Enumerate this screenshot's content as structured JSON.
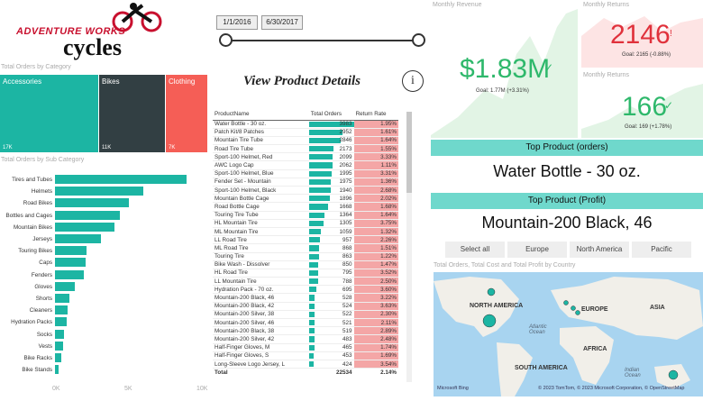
{
  "brand": {
    "line1": "ADVENTURE WORKS",
    "line2": "cycles"
  },
  "dates": {
    "start": "1/1/2016",
    "end": "6/30/2017"
  },
  "view_details": {
    "label": "View Product Details",
    "info_icon": "i"
  },
  "treemap": {
    "title": "Total Orders by Category",
    "tiles": [
      {
        "name": "Accessories",
        "value": "17K",
        "color": "#1cb5a3"
      },
      {
        "name": "Bikes",
        "value": "11K",
        "color": "#323f43"
      },
      {
        "name": "Clothing",
        "value": "7K",
        "color": "#f55e56"
      }
    ]
  },
  "subcat": {
    "title": "Total Orders by Sub Category",
    "axis": [
      "0K",
      "5K",
      "10K"
    ],
    "xmax": 10000,
    "rows": [
      {
        "name": "Tires and Tubes",
        "value": 9100
      },
      {
        "name": "Helmets",
        "value": 6100
      },
      {
        "name": "Road Bikes",
        "value": 5100
      },
      {
        "name": "Bottles and Cages",
        "value": 4500
      },
      {
        "name": "Mountain Bikes",
        "value": 4100
      },
      {
        "name": "Jerseys",
        "value": 3200
      },
      {
        "name": "Touring Bikes",
        "value": 2200
      },
      {
        "name": "Caps",
        "value": 2100
      },
      {
        "name": "Fenders",
        "value": 2000
      },
      {
        "name": "Gloves",
        "value": 1400
      },
      {
        "name": "Shorts",
        "value": 1000
      },
      {
        "name": "Cleaners",
        "value": 900
      },
      {
        "name": "Hydration Packs",
        "value": 800
      },
      {
        "name": "Socks",
        "value": 600
      },
      {
        "name": "Vests",
        "value": 550
      },
      {
        "name": "Bike Racks",
        "value": 450
      },
      {
        "name": "Bike Stands",
        "value": 250
      }
    ]
  },
  "product_table": {
    "headers": [
      "ProductName",
      "Total Orders",
      "Return Rate"
    ],
    "max_orders": 3983,
    "rows": [
      [
        "Water Bottle - 30 oz.",
        3983,
        "1.95%"
      ],
      [
        "Patch Kit/8 Patches",
        2952,
        "1.61%"
      ],
      [
        "Mountain Tire Tube",
        2846,
        "1.64%"
      ],
      [
        "Road Tire Tube",
        2173,
        "1.55%"
      ],
      [
        "Sport-100 Helmet, Red",
        2099,
        "3.33%"
      ],
      [
        "AWC Logo Cap",
        2062,
        "1.11%"
      ],
      [
        "Sport-100 Helmet, Blue",
        1995,
        "3.31%"
      ],
      [
        "Fender Set - Mountain",
        1975,
        "1.36%"
      ],
      [
        "Sport-100 Helmet, Black",
        1940,
        "2.68%"
      ],
      [
        "Mountain Bottle Cage",
        1896,
        "2.02%"
      ],
      [
        "Road Bottle Cage",
        1668,
        "1.68%"
      ],
      [
        "Touring Tire Tube",
        1364,
        "1.64%"
      ],
      [
        "HL Mountain Tire",
        1305,
        "3.75%"
      ],
      [
        "ML Mountain Tire",
        1059,
        "1.32%"
      ],
      [
        "LL Road Tire",
        957,
        "2.26%"
      ],
      [
        "ML Road Tire",
        868,
        "1.51%"
      ],
      [
        "Touring Tire",
        863,
        "1.22%"
      ],
      [
        "Bike Wash - Dissolver",
        850,
        "1.47%"
      ],
      [
        "HL Road Tire",
        795,
        "3.52%"
      ],
      [
        "LL Mountain Tire",
        788,
        "2.50%"
      ],
      [
        "Hydration Pack - 70 oz.",
        695,
        "3.60%"
      ],
      [
        "Mountain-200 Black, 46",
        528,
        "3.22%"
      ],
      [
        "Mountain-200 Black, 42",
        524,
        "3.63%"
      ],
      [
        "Mountain-200 Silver, 38",
        522,
        "2.30%"
      ],
      [
        "Mountain-200 Silver, 46",
        521,
        "2.11%"
      ],
      [
        "Mountain-200 Black, 38",
        519,
        "2.89%"
      ],
      [
        "Mountain-200 Silver, 42",
        483,
        "2.48%"
      ],
      [
        "Half-Finger Gloves, M",
        465,
        "1.74%"
      ],
      [
        "Half-Finger Gloves, S",
        453,
        "1.69%"
      ],
      [
        "Long-Sleeve Logo Jersey, L",
        424,
        "3.54%"
      ]
    ],
    "total": [
      "Total",
      "22534",
      "2.14%"
    ]
  },
  "kpi": {
    "revenue": {
      "title": "Monthly Revenue",
      "value": "$1.83M",
      "goal": "Goal: 1.77M (+3.31%)"
    },
    "returns": {
      "title": "Monthly Returns",
      "value": "2146",
      "mark": "!",
      "goal": "Goal: 2165 (-0.88%)"
    },
    "orders": {
      "title": "Monthly Returns",
      "value": "166",
      "goal": "Goal: 169 (+1.78%)"
    }
  },
  "top_orders": {
    "title": "Top Product (orders)",
    "value": "Water Bottle - 30 oz."
  },
  "top_profit": {
    "title": "Top Product (Profit)",
    "value": "Mountain-200 Black, 46"
  },
  "regions": [
    "Select all",
    "Europe",
    "North America",
    "Pacific"
  ],
  "map": {
    "title": "Total Orders, Total Cost and Total Profit by Country",
    "labels": [
      "NORTH AMERICA",
      "EUROPE",
      "ASIA",
      "AFRICA",
      "SOUTH AMERICA"
    ],
    "oceans": [
      "Atlantic\nOcean",
      "Indian\nOcean"
    ],
    "credits": "© 2023 TomTom, © 2023 Microsoft Corporation, © OpenStreetMap",
    "provider": "Microsoft Bing"
  }
}
